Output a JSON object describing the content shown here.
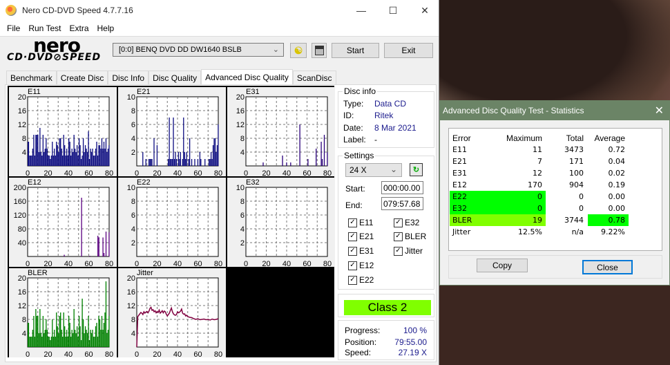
{
  "window": {
    "title": "Nero CD-DVD Speed 4.7.7.16",
    "controls": [
      "—",
      "☐",
      "✕"
    ]
  },
  "menu": [
    "File",
    "Run Test",
    "Extra",
    "Help"
  ],
  "toolbar": {
    "logo_top": "nero",
    "logo_bottom": "CD·DVD⊘SPEED",
    "drive": "[0:0]   BENQ DVD DD DW1640 BSLB",
    "start_label": "Start",
    "exit_label": "Exit"
  },
  "tabs": [
    {
      "label": "Benchmark",
      "active": false
    },
    {
      "label": "Create Disc",
      "active": false
    },
    {
      "label": "Disc Info",
      "active": false
    },
    {
      "label": "Disc Quality",
      "active": false
    },
    {
      "label": "Advanced Disc Quality",
      "active": true
    },
    {
      "label": "ScanDisc",
      "active": false
    }
  ],
  "disc_info": {
    "legend": "Disc info",
    "rows": [
      {
        "label": "Type:",
        "value": "Data CD"
      },
      {
        "label": "ID:",
        "value": "Ritek"
      },
      {
        "label": "Date:",
        "value": "8 Mar 2021"
      },
      {
        "label": "Label:",
        "value": "-"
      }
    ]
  },
  "settings": {
    "legend": "Settings",
    "speed": "24 X",
    "start_label": "Start:",
    "start_value": "000:00.00",
    "end_label": "End:",
    "end_value": "079:57.68",
    "checkboxes": [
      {
        "label": "E11",
        "checked": true
      },
      {
        "label": "E21",
        "checked": true
      },
      {
        "label": "E31",
        "checked": true
      },
      {
        "label": "E12",
        "checked": true
      },
      {
        "label": "E22",
        "checked": true
      },
      {
        "label": "E32",
        "checked": true
      },
      {
        "label": "BLER",
        "checked": true
      },
      {
        "label": "Jitter",
        "checked": true
      }
    ]
  },
  "result": {
    "class_label": "Class 2",
    "class_color": "#80ff00"
  },
  "progress": {
    "progress_label": "Progress:",
    "progress_value": "100 %",
    "position_label": "Position:",
    "position_value": "79:55.00",
    "speed_label": "Speed:",
    "speed_value": "27.19 X"
  },
  "chart_data": [
    {
      "type": "bar",
      "title": "E11",
      "xlim": [
        0,
        80
      ],
      "ylim": [
        0,
        20
      ],
      "xticks": [
        "0",
        "20",
        "40",
        "60",
        "80"
      ],
      "yticks": [
        "4",
        "8",
        "12",
        "16",
        "20"
      ],
      "color": "#0d0d80",
      "grid": true,
      "values": [
        7,
        7,
        3,
        3,
        3,
        5,
        9,
        3,
        9,
        9,
        9,
        4,
        11,
        4,
        3,
        9,
        4,
        5,
        8,
        5,
        3,
        3,
        2,
        3,
        7,
        3,
        5,
        3,
        7,
        6,
        4,
        8,
        8,
        5,
        3,
        9,
        6,
        3,
        5,
        3,
        8,
        7,
        3,
        5,
        4,
        9,
        5,
        4,
        6,
        3,
        8,
        6,
        2,
        3,
        8,
        4,
        6,
        5,
        4,
        10,
        2,
        5,
        4,
        5,
        3,
        3,
        5,
        7,
        3,
        6,
        6,
        5,
        8,
        5,
        7,
        5,
        8,
        4,
        5,
        6
      ]
    },
    {
      "type": "bar",
      "title": "E21",
      "xlim": [
        0,
        80
      ],
      "ylim": [
        0,
        10
      ],
      "xticks": [
        "0",
        "20",
        "40",
        "60",
        "80"
      ],
      "yticks": [
        "2",
        "4",
        "6",
        "8",
        "10"
      ],
      "color": "#0d0d80",
      "grid": true,
      "values": [
        0,
        0,
        0,
        0,
        0,
        0,
        2,
        0,
        0,
        1,
        0,
        0,
        1,
        1,
        1,
        1,
        0,
        4,
        0,
        0,
        3,
        0,
        0,
        0,
        0,
        0,
        0,
        0,
        0,
        0,
        0,
        1,
        7,
        1,
        1,
        1,
        7,
        1,
        2,
        1,
        0,
        2,
        1,
        2,
        0,
        1,
        7,
        2,
        1,
        2,
        0,
        1,
        4,
        0,
        1,
        0,
        0,
        1,
        0,
        0,
        1,
        0,
        2,
        1,
        0,
        0,
        0,
        1,
        0,
        0,
        0,
        1,
        1,
        2,
        1,
        3,
        4,
        4,
        2,
        3,
        6
      ]
    },
    {
      "type": "bar",
      "title": "E31",
      "xlim": [
        0,
        80
      ],
      "ylim": [
        0,
        20
      ],
      "xticks": [
        "0",
        "20",
        "40",
        "60",
        "80"
      ],
      "yticks": [
        "4",
        "8",
        "12",
        "16",
        "20"
      ],
      "color": "#2a007a",
      "grid": true,
      "values": [
        0,
        0,
        0,
        0,
        0,
        0,
        0,
        0,
        0,
        0,
        0,
        0,
        0,
        0,
        0,
        0,
        0,
        1,
        0,
        0,
        0,
        0,
        0,
        0,
        0,
        0,
        0,
        0,
        0,
        0,
        0,
        0,
        0,
        0,
        0,
        0,
        3,
        0,
        0,
        0,
        1,
        0,
        0,
        0,
        1,
        0,
        0,
        0,
        0,
        0,
        0,
        0,
        0,
        12,
        0,
        0,
        0,
        0,
        0,
        0,
        0,
        2,
        0,
        0,
        0,
        0,
        0,
        0,
        0,
        5,
        0,
        0,
        0,
        0,
        7,
        2,
        0,
        9,
        0,
        0,
        4
      ]
    },
    {
      "type": "bar",
      "title": "E12",
      "xlim": [
        0,
        80
      ],
      "ylim": [
        0,
        200
      ],
      "xticks": [
        "0",
        "20",
        "40",
        "60",
        "80"
      ],
      "yticks": [
        "40",
        "80",
        "120",
        "160",
        "200"
      ],
      "color": "#5a0080",
      "grid": true,
      "values": [
        0,
        0,
        0,
        0,
        0,
        0,
        0,
        0,
        0,
        0,
        0,
        0,
        0,
        0,
        0,
        0,
        0,
        0,
        0,
        0,
        0,
        0,
        0,
        0,
        0,
        0,
        0,
        0,
        0,
        0,
        0,
        0,
        0,
        0,
        0,
        0,
        5,
        0,
        0,
        0,
        0,
        0,
        0,
        0,
        0,
        0,
        0,
        0,
        0,
        0,
        0,
        0,
        0,
        170,
        0,
        0,
        0,
        0,
        0,
        0,
        0,
        2,
        0,
        0,
        0,
        0,
        0,
        0,
        0,
        60,
        55,
        0,
        0,
        0,
        55,
        10,
        0,
        72,
        0,
        0,
        70
      ]
    },
    {
      "type": "bar",
      "title": "E22",
      "xlim": [
        0,
        80
      ],
      "ylim": [
        0,
        10
      ],
      "xticks": [
        "0",
        "20",
        "40",
        "60",
        "80"
      ],
      "yticks": [
        "2",
        "4",
        "6",
        "8",
        "10"
      ],
      "color": "#0d0d80",
      "grid": true,
      "values": []
    },
    {
      "type": "bar",
      "title": "E32",
      "xlim": [
        0,
        80
      ],
      "ylim": [
        0,
        10
      ],
      "xticks": [
        "0",
        "20",
        "40",
        "60",
        "80"
      ],
      "yticks": [
        "2",
        "4",
        "6",
        "8",
        "10"
      ],
      "color": "#0d0d80",
      "grid": true,
      "values": []
    },
    {
      "type": "bar",
      "title": "BLER",
      "xlim": [
        0,
        80
      ],
      "ylim": [
        0,
        20
      ],
      "xticks": [
        "0",
        "20",
        "40",
        "60",
        "80"
      ],
      "yticks": [
        "4",
        "8",
        "12",
        "16",
        "20"
      ],
      "color": "#008000",
      "grid": true,
      "values": [
        7,
        7,
        3,
        3,
        3,
        5,
        9,
        3,
        11,
        9,
        9,
        4,
        11,
        4,
        3,
        9,
        4,
        5,
        8,
        5,
        3,
        3,
        2,
        3,
        8,
        3,
        5,
        3,
        10,
        6,
        4,
        9,
        10,
        5,
        3,
        10,
        6,
        3,
        5,
        3,
        9,
        7,
        3,
        5,
        4,
        11,
        5,
        4,
        6,
        3,
        9,
        6,
        2,
        14,
        8,
        4,
        6,
        5,
        4,
        9,
        2,
        5,
        4,
        5,
        3,
        3,
        6,
        7,
        3,
        9,
        8,
        5,
        9,
        5,
        7,
        10,
        19,
        4,
        5,
        9
      ]
    },
    {
      "type": "line",
      "title": "Jitter",
      "xlim": [
        0,
        80
      ],
      "ylim": [
        0,
        20
      ],
      "xticks": [
        "0",
        "20",
        "40",
        "60",
        "80"
      ],
      "yticks": [
        "4",
        "8",
        "12",
        "16",
        "20"
      ],
      "color": "#800040",
      "grid": true,
      "x": [
        0,
        1,
        2,
        3,
        4,
        5,
        6,
        7,
        8,
        9,
        10,
        11,
        12,
        13,
        14,
        15,
        16,
        17,
        18,
        19,
        20,
        21,
        22,
        23,
        24,
        25,
        26,
        27,
        28,
        29,
        30,
        31,
        32,
        33,
        34,
        35,
        36,
        37,
        38,
        39,
        40,
        41,
        42,
        43,
        44,
        45,
        46,
        47,
        48,
        49,
        50,
        52,
        54,
        56,
        58,
        60,
        62,
        64,
        66,
        68,
        70,
        72,
        74,
        76,
        78,
        80
      ],
      "values": [
        0,
        8.8,
        9.2,
        9.6,
        10.0,
        9.8,
        9.4,
        10.2,
        9.8,
        10.1,
        10.3,
        9.9,
        10.4,
        11.2,
        11.5,
        10.6,
        10.8,
        10.2,
        10.5,
        9.9,
        10.3,
        10.0,
        10.7,
        9.8,
        10.1,
        10.5,
        9.9,
        10.4,
        10.2,
        9.5,
        9.0,
        9.4,
        9.8,
        10.6,
        11.3,
        10.2,
        9.6,
        9.3,
        9.2,
        9.4,
        10.2,
        9.9,
        10.1,
        10.4,
        11.0,
        9.8,
        9.5,
        9.6,
        9.0,
        9.2,
        8.8,
        8.6,
        8.5,
        8.2,
        8.0,
        8.2,
        7.9,
        8.0,
        8.1,
        7.9,
        8.0,
        7.8,
        8.1,
        7.9,
        8.0,
        8.2
      ]
    }
  ],
  "stats_dialog": {
    "title": "Advanced Disc Quality Test - Statistics",
    "headers": [
      "Error",
      "Maximum",
      "Total",
      "Average"
    ],
    "rows": [
      {
        "error": "E11",
        "maximum": "11",
        "total": "3473",
        "average": "0.72",
        "hl_err": "",
        "hl_avg": ""
      },
      {
        "error": "E21",
        "maximum": "7",
        "total": "171",
        "average": "0.04",
        "hl_err": "",
        "hl_avg": ""
      },
      {
        "error": "E31",
        "maximum": "12",
        "total": "100",
        "average": "0.02",
        "hl_err": "",
        "hl_avg": ""
      },
      {
        "error": "E12",
        "maximum": "170",
        "total": "904",
        "average": "0.19",
        "hl_err": "",
        "hl_avg": ""
      },
      {
        "error": "E22",
        "maximum": "0",
        "total": "0",
        "average": "0.00",
        "hl_err": "#00ff00",
        "hl_avg": ""
      },
      {
        "error": "E32",
        "maximum": "0",
        "total": "0",
        "average": "0.00",
        "hl_err": "#00ff00",
        "hl_avg": ""
      },
      {
        "error": "BLER",
        "maximum": "19",
        "total": "3744",
        "average": "0.78",
        "hl_err": "#80ff00",
        "hl_avg": "#00ff00"
      },
      {
        "error": "Jitter",
        "maximum": "12.5%",
        "total": "n/a",
        "average": "9.22%",
        "hl_err": "",
        "hl_avg": ""
      }
    ],
    "copy_label": "Copy",
    "close_label": "Close"
  }
}
